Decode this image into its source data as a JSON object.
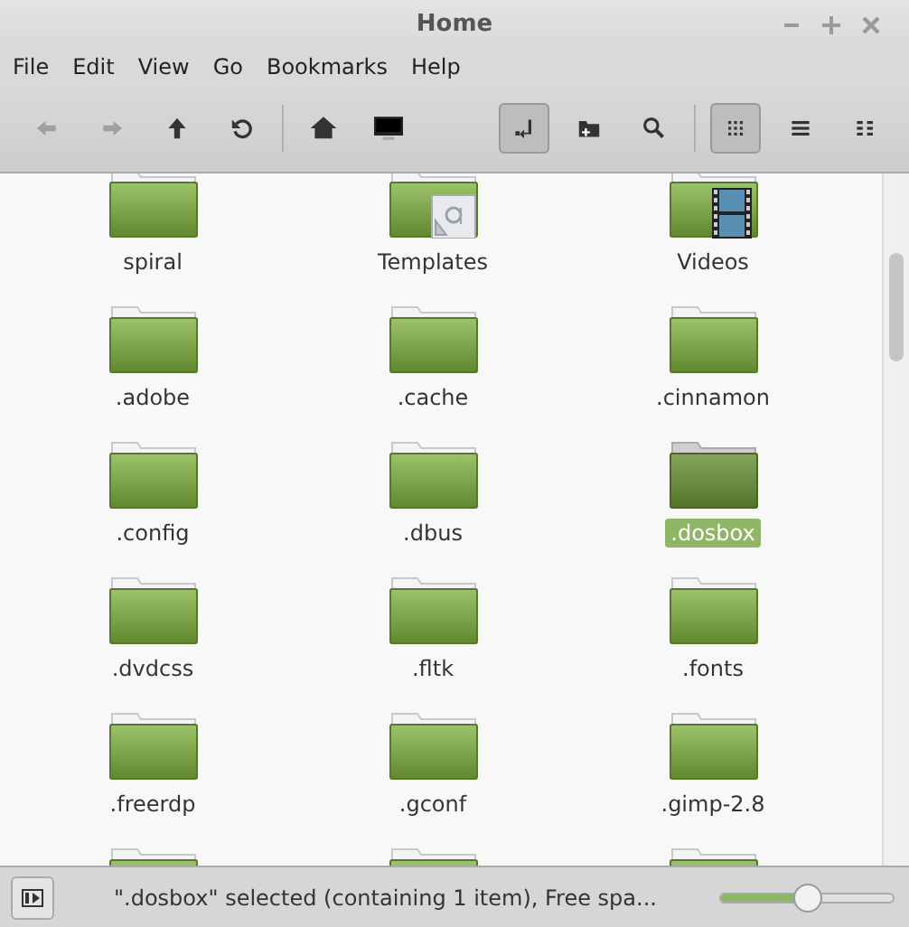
{
  "window": {
    "title": "Home"
  },
  "menu": [
    "File",
    "Edit",
    "View",
    "Go",
    "Bookmarks",
    "Help"
  ],
  "navigation": [
    {
      "kind": "back",
      "disabled": true
    },
    {
      "kind": "forward",
      "disabled": true
    },
    {
      "kind": "up",
      "disabled": false
    },
    {
      "kind": "reload",
      "disabled": false
    }
  ],
  "places": [
    {
      "kind": "home"
    },
    {
      "kind": "computer"
    }
  ],
  "tools": [
    {
      "kind": "location",
      "selected": true
    },
    {
      "kind": "newfolder",
      "selected": false
    },
    {
      "kind": "search",
      "selected": false
    }
  ],
  "view_modes": [
    {
      "kind": "icons",
      "selected": true
    },
    {
      "kind": "list",
      "selected": false
    },
    {
      "kind": "compact",
      "selected": false
    }
  ],
  "files": [
    {
      "label": "spiral",
      "kind": "folder",
      "selected": false
    },
    {
      "label": "Templates",
      "kind": "templates",
      "selected": false
    },
    {
      "label": "Videos",
      "kind": "videos",
      "selected": false
    },
    {
      "label": ".adobe",
      "kind": "folder",
      "selected": false
    },
    {
      "label": ".cache",
      "kind": "folder",
      "selected": false
    },
    {
      "label": ".cinnamon",
      "kind": "folder",
      "selected": false
    },
    {
      "label": ".config",
      "kind": "folder",
      "selected": false
    },
    {
      "label": ".dbus",
      "kind": "folder",
      "selected": false
    },
    {
      "label": ".dosbox",
      "kind": "folder",
      "selected": true
    },
    {
      "label": ".dvdcss",
      "kind": "folder",
      "selected": false
    },
    {
      "label": ".fltk",
      "kind": "folder",
      "selected": false
    },
    {
      "label": ".fonts",
      "kind": "folder",
      "selected": false
    },
    {
      "label": ".freerdp",
      "kind": "folder",
      "selected": false
    },
    {
      "label": ".gconf",
      "kind": "folder",
      "selected": false
    },
    {
      "label": ".gimp-2.8",
      "kind": "folder",
      "selected": false
    },
    {
      "kind": "folder",
      "selected": false
    },
    {
      "kind": "folder",
      "selected": false
    },
    {
      "kind": "folder",
      "selected": false
    }
  ],
  "status_bar": {
    "text": "\".dosbox\" selected (containing 1 item), Free spa...",
    "zoom": {
      "level": 0.5
    }
  }
}
